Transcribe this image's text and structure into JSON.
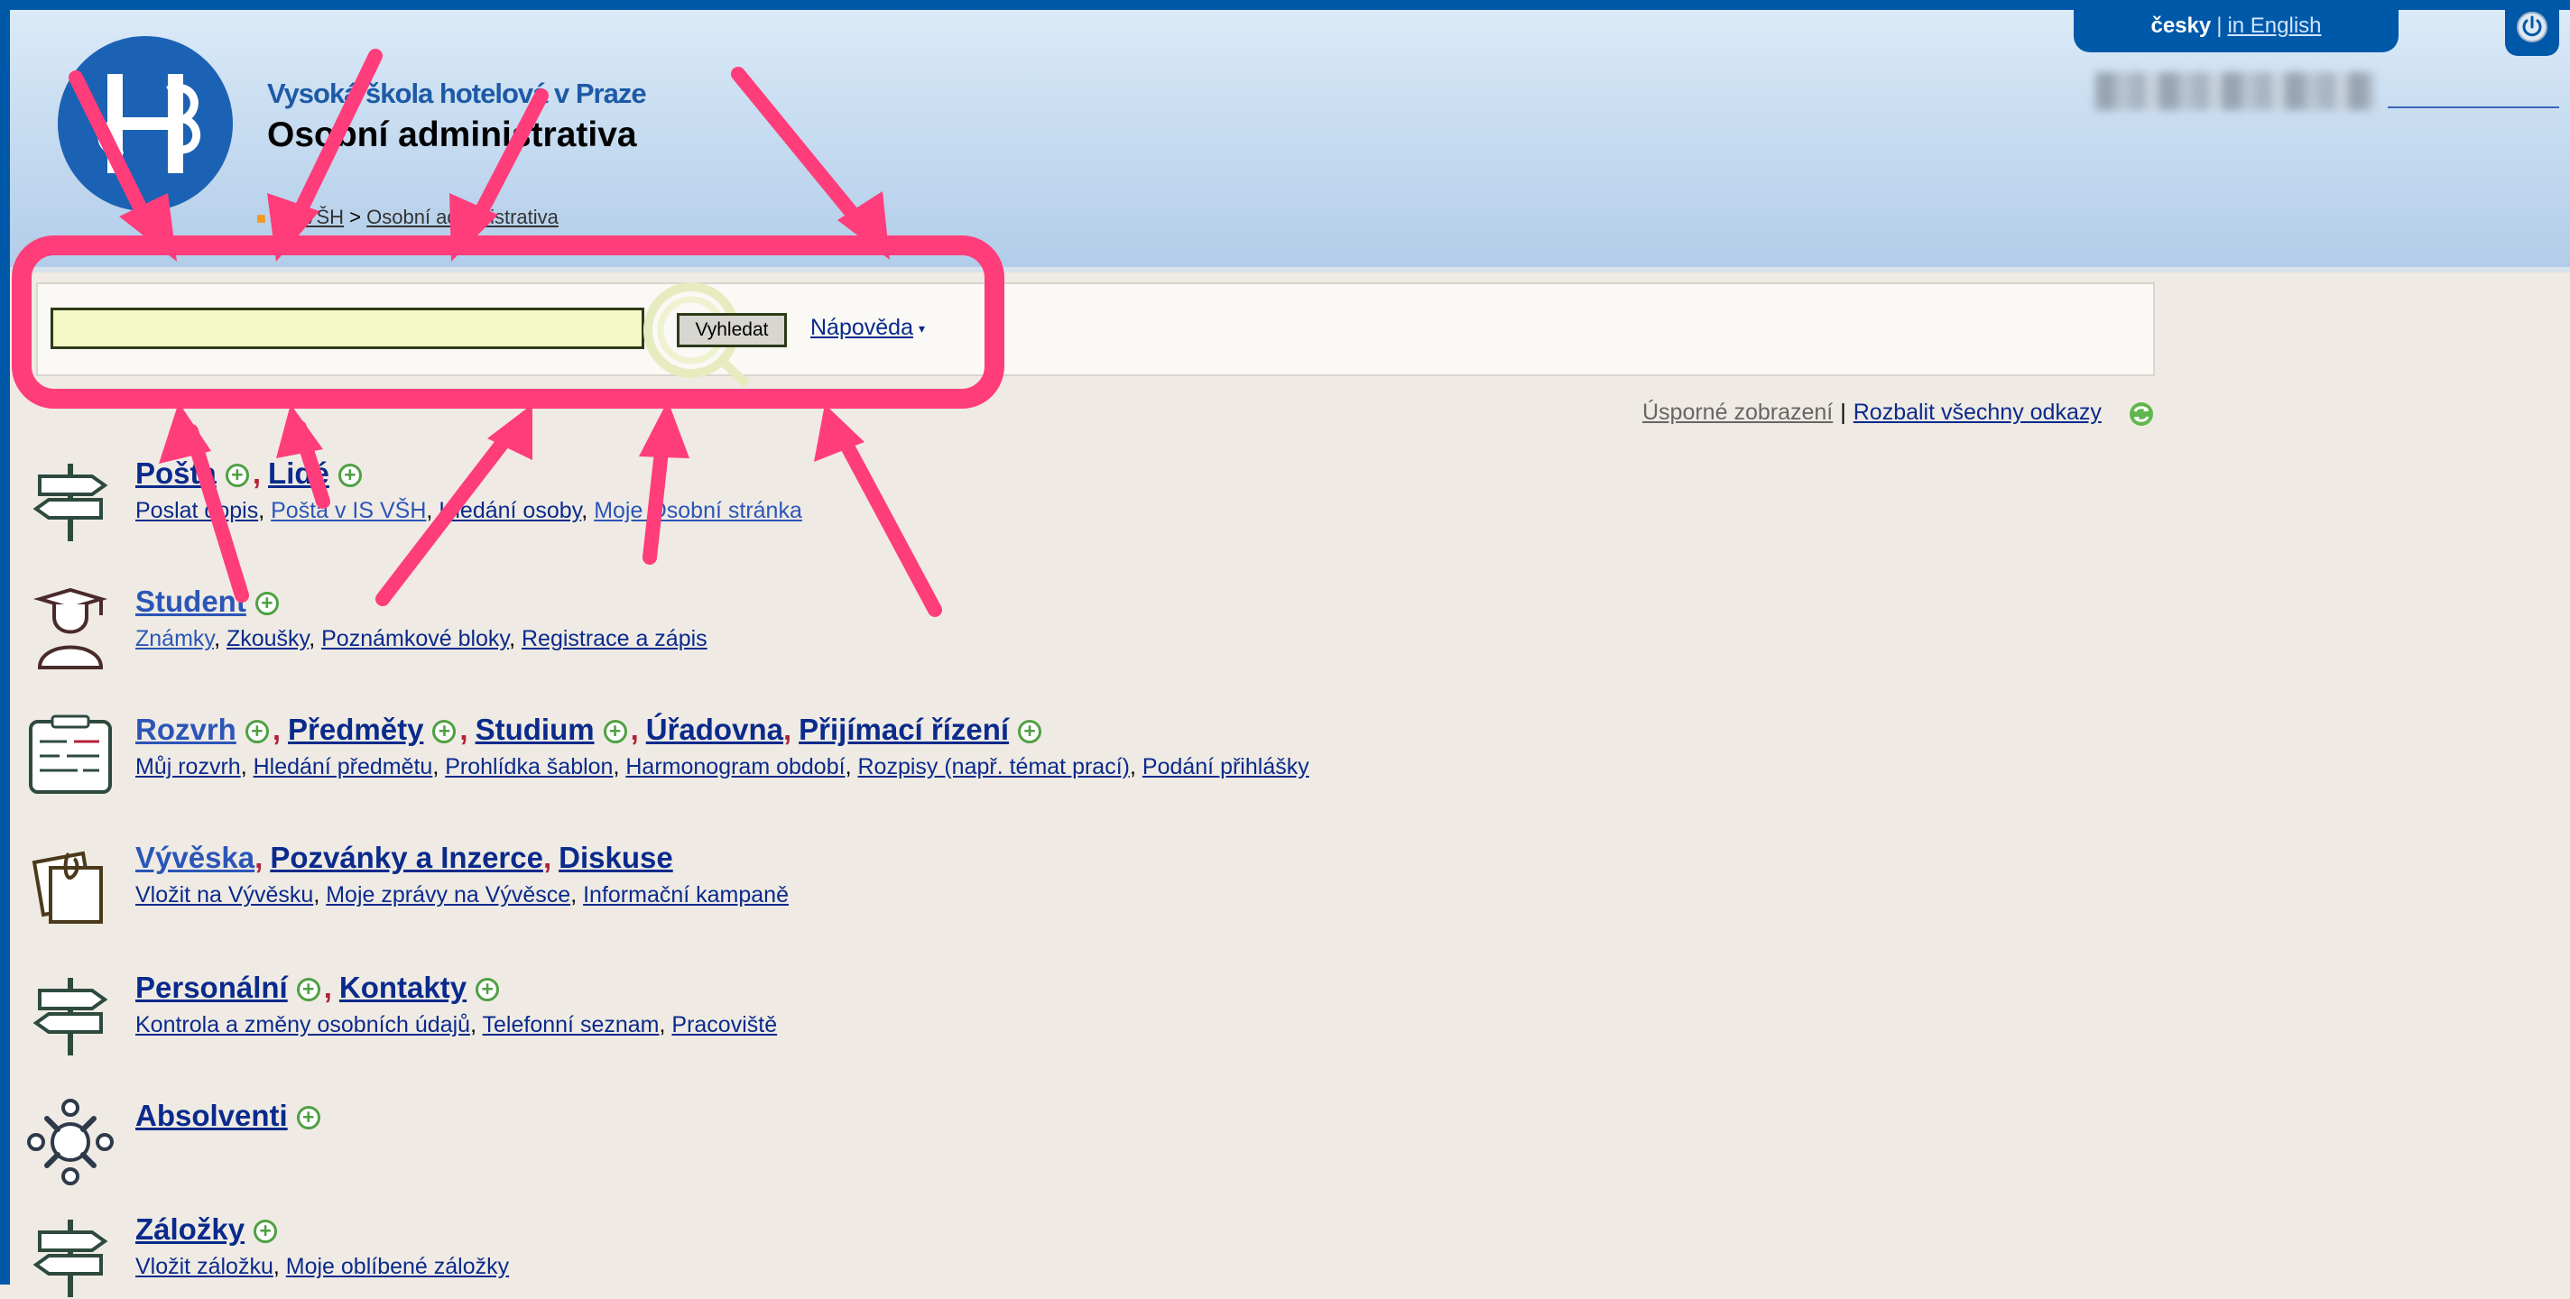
{
  "colors": {
    "frame": "#0058a8",
    "link": "#0a2a8c",
    "annotation": "#ff3d7b",
    "search_bg": "#f4f8c6",
    "plus": "#4fa043"
  },
  "header": {
    "school_name": "Vysoká škola hotelová v Praze",
    "app_title": "Osobní administrativa",
    "breadcrumb": {
      "root": "IS VŠH",
      "separator": ">",
      "current": "Osobní administrativa"
    },
    "language": {
      "current": "česky",
      "separator": "|",
      "other": "in English"
    },
    "power_icon": "power-icon",
    "logo_icon": "vsh-logo"
  },
  "search": {
    "value": "",
    "button_label": "Vyhledat",
    "help_label": "Nápověda",
    "help_caret": "▾"
  },
  "view": {
    "compact_label": "Úsporné zobrazení",
    "separator": "|",
    "expand_label": "Rozbalit všechny odkazy"
  },
  "sections": [
    {
      "icon": "signpost-icon",
      "titles": [
        "Pošta",
        "Lidé"
      ],
      "links": [
        "Poslat dopis",
        "Pošta v IS VŠH",
        "Hledání osoby",
        "Moje Osobní stránka"
      ]
    },
    {
      "icon": "graduate-icon",
      "titles": [
        "Student"
      ],
      "links": [
        "Známky",
        "Zkoušky",
        "Poznámkové bloky",
        "Registrace a zápis"
      ]
    },
    {
      "icon": "schedule-icon",
      "titles": [
        "Rozvrh",
        "Předměty",
        "Studium",
        "Úřadovna",
        "Přijímací řízení"
      ],
      "links": [
        "Můj rozvrh",
        "Hledání předmětu",
        "Prohlídka šablon",
        "Harmonogram období",
        "Rozpisy (např. témat prací)",
        "Podání přihlášky"
      ]
    },
    {
      "icon": "notes-icon",
      "titles": [
        "Vývěska",
        "Pozvánky a Inzerce",
        "Diskuse"
      ],
      "links": [
        "Vložit na Vývěsku",
        "Moje zprávy na Vývěsce",
        "Informační kampaně"
      ]
    },
    {
      "icon": "signpost-icon",
      "titles": [
        "Personální",
        "Kontakty"
      ],
      "links": [
        "Kontrola a změny osobních údajů",
        "Telefonní seznam",
        "Pracoviště"
      ]
    },
    {
      "icon": "people-circle-icon",
      "titles": [
        "Absolventi"
      ],
      "links": []
    },
    {
      "icon": "signpost-icon",
      "titles": [
        "Záložky"
      ],
      "links": [
        "Vložit záložku",
        "Moje oblíbené záložky"
      ]
    }
  ]
}
